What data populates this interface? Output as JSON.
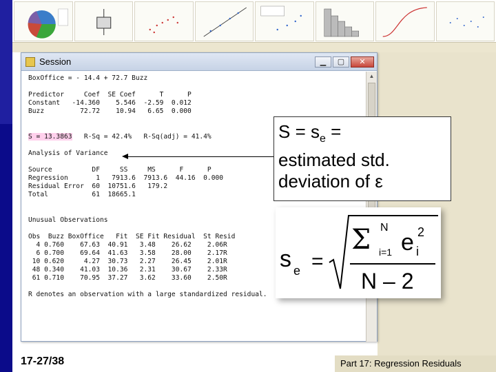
{
  "window": {
    "title": "Session"
  },
  "session_lines": [
    "BoxOffice = - 14.4 + 72.7 Buzz",
    "",
    "Predictor     Coef  SE Coef      T      P",
    "Constant   -14.360    5.546  -2.59  0.012",
    "Buzz         72.72    10.94   6.65  0.000",
    "",
    "",
    "__S__   R-Sq = 42.4%   R-Sq(adj) = 41.4%",
    "",
    "Analysis of Variance",
    "",
    "Source          DF     SS     MS      F      P",
    "Regression       1   7913.6  7913.6  44.16  0.000",
    "Residual Error  60  10751.6   179.2",
    "Total           61  18665.1",
    "",
    "",
    "Unusual Observations",
    "",
    "Obs  Buzz BoxOffice   Fit  SE Fit Residual  St Resid",
    "  4 0.760    67.63  40.91   3.48    26.62    2.06R",
    "  6 0.700    69.64  41.63   3.58    28.00    2.17R",
    " 10 0.620     4.27  30.73   2.27    26.45    2.01R",
    " 48 0.340    41.03  10.36   2.31    30.67    2.33R",
    " 61 0.710    70.95  37.27   3.62    33.60    2.50R",
    "",
    "R denotes an observation with a large standardized residual."
  ],
  "s_value": "S = 13.3863",
  "callout": {
    "line1": "S = s",
    "line1_sub": "e",
    "line1_end": " =",
    "line2": "estimated std.",
    "line3": "deviation of ε"
  },
  "formula": {
    "lhs": "s",
    "lhs_sub": "e",
    "equals": "=",
    "sum": "Σ",
    "sum_upper": "N",
    "sum_lower": "i=1",
    "term": "e",
    "term_sub": "i",
    "term_sup": "2",
    "denominator": "N – 2"
  },
  "slide_number": "17-27/38",
  "footer": "Part 17: Regression Residuals",
  "colors": {
    "left_bar": "#1f1fa0",
    "highlight": "#ffd0ec",
    "footer_bg": "#e3ddc4"
  }
}
